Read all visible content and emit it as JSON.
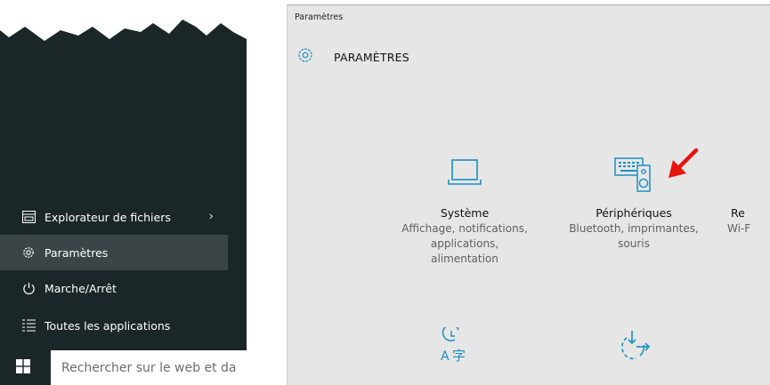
{
  "start_menu": {
    "items": [
      {
        "label": "Explorateur de fichiers",
        "icon": "file-explorer-icon",
        "has_submenu": true
      },
      {
        "label": "Paramètres",
        "icon": "gear-icon",
        "active": true
      },
      {
        "label": "Marche/Arrêt",
        "icon": "power-icon"
      },
      {
        "label": "Toutes les applications",
        "icon": "all-apps-icon"
      }
    ],
    "submenu_chevron": "›"
  },
  "taskbar": {
    "search_placeholder": "Rechercher sur le web et da"
  },
  "settings": {
    "window_title": "Paramètres",
    "header": "PARAMÈTRES",
    "tiles": [
      {
        "icon": "laptop-icon",
        "title": "Système",
        "description_lines": [
          "Affichage, notifications,",
          "applications,",
          "alimentation"
        ]
      },
      {
        "icon": "devices-icon",
        "title": "Périphériques",
        "description_lines": [
          "Bluetooth, imprimantes,",
          "souris"
        ]
      },
      {
        "icon": "network-icon",
        "title": "Re",
        "description_lines": [
          "Wi-F"
        ]
      },
      {
        "icon": "time-language-icon"
      },
      {
        "icon": "update-security-icon"
      }
    ],
    "accent_color": "#1a8fc4",
    "annotation_arrow_color": "#e8140f"
  }
}
